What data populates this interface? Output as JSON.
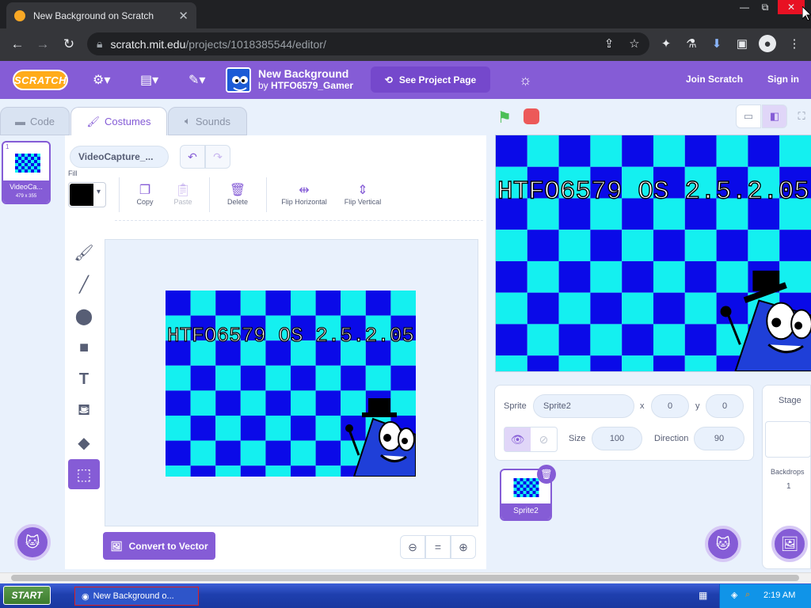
{
  "browser": {
    "tab_title": "New Background on Scratch",
    "url_host": "scratch.mit.edu",
    "url_path": "/projects/1018385544/editor/",
    "win_min": "—",
    "win_max": "⧉",
    "win_close": "✕"
  },
  "menu": {
    "logo": "SCRATCH",
    "project_title": "New Background",
    "by_prefix": "by",
    "project_author": "HTFO6579_Gamer",
    "see_project": "See Project Page",
    "join": "Join Scratch",
    "signin": "Sign in"
  },
  "tabs": {
    "code": "Code",
    "costumes": "Costumes",
    "sounds": "Sounds"
  },
  "costume_list": [
    {
      "number": "1",
      "name": "VideoCa...",
      "size": "479 x 355"
    }
  ],
  "paint": {
    "costume_name": "VideoCapture_...",
    "fill_label": "Fill",
    "fill_color": "#000000",
    "tools": {
      "copy": "Copy",
      "paste": "Paste",
      "delete": "Delete",
      "flip_h": "Flip Horizontal",
      "flip_v": "Flip Vertical"
    },
    "convert": "Convert to Vector",
    "zoom_out": "⊖",
    "zoom_reset": "=",
    "zoom_in": "⊕"
  },
  "artwork": {
    "text": "HTFO6579 OS 2.5.2.05",
    "colors": {
      "dark": "#0a0ae8",
      "light": "#14f0f0"
    }
  },
  "sprite_info": {
    "sprite_label": "Sprite",
    "name": "Sprite2",
    "x_label": "x",
    "x": "0",
    "y_label": "y",
    "y": "0",
    "size_label": "Size",
    "size": "100",
    "direction_label": "Direction",
    "direction": "90"
  },
  "sprites": [
    {
      "name": "Sprite2"
    }
  ],
  "stage_panel": {
    "title": "Stage",
    "backdrops_label": "Backdrops",
    "backdrops_count": "1"
  },
  "taskbar": {
    "start": "START",
    "item": "New Background o...",
    "time": "2:19 AM"
  },
  "colors": {
    "accent": "#855cd6",
    "menu_bg": "#855cd6",
    "editor_bg": "#e9f1fc"
  }
}
